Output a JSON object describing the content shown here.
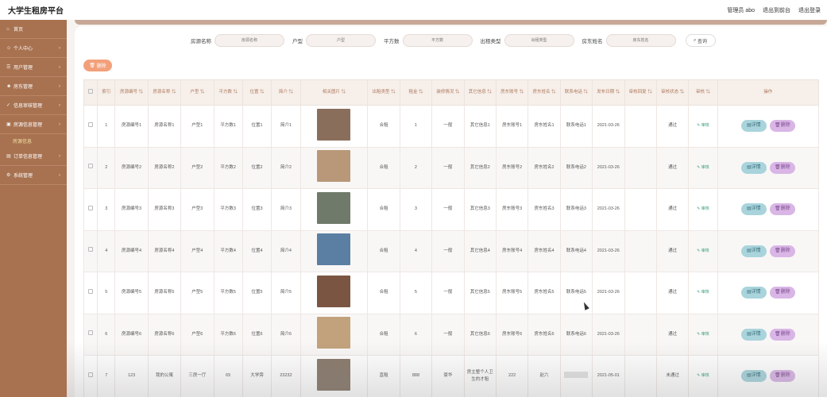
{
  "app": {
    "title": "大学生租房平台"
  },
  "topbar": {
    "user": "管理员 abo",
    "to_front": "退出到前台",
    "logout": "退出登录"
  },
  "sidebar": {
    "items": [
      {
        "label": "首页",
        "icon": "home-icon",
        "chev": ""
      },
      {
        "label": "个人中心",
        "icon": "user-icon",
        "chev": "›"
      },
      {
        "label": "用户管理",
        "icon": "users-icon",
        "chev": "›"
      },
      {
        "label": "房东管理",
        "icon": "person-icon",
        "chev": "›"
      },
      {
        "label": "信息审核管理",
        "icon": "check-icon",
        "chev": "›"
      },
      {
        "label": "房源信息管理",
        "icon": "house-icon",
        "chev": "›"
      }
    ],
    "active_sub": "房源信息",
    "items_after": [
      {
        "label": "订单信息管理",
        "icon": "order-icon",
        "chev": "›"
      },
      {
        "label": "系统管理",
        "icon": "gear-icon",
        "chev": "›"
      }
    ]
  },
  "search": {
    "fields": [
      {
        "label": "房源名称",
        "placeholder": "房源名称"
      },
      {
        "label": "户型",
        "placeholder": "户型"
      },
      {
        "label": "平方数",
        "placeholder": "平方数"
      },
      {
        "label": "出租类型",
        "placeholder": "出租类型"
      },
      {
        "label": "房东姓名",
        "placeholder": "房东姓名"
      }
    ],
    "button": "查询"
  },
  "toolbar": {
    "delete": "删除"
  },
  "table": {
    "headers": [
      "索引",
      "房源编号 ⇅",
      "房源名称 ⇅",
      "户型 ⇅",
      "平方数 ⇅",
      "位置 ⇅",
      "简介 ⇅",
      "相关图片 ⇅",
      "出租类型 ⇅",
      "租金 ⇅",
      "装修情况 ⇅",
      "其它信息 ⇅",
      "房东账号 ⇅",
      "房东姓名 ⇅",
      "联系电话 ⇅",
      "发布日期 ⇅",
      "审核回复 ⇅",
      "审核状态 ⇅",
      "审核 ⇅",
      "操作"
    ],
    "audit_label": "审核",
    "detail_label": "详情",
    "del_label": "删除",
    "rows": [
      {
        "idx": "1",
        "code": "房源编号1",
        "name": "房源名称1",
        "type": "户型1",
        "area": "平方数1",
        "loc": "位置1",
        "intro": "简介1",
        "img": "#8a6e5c",
        "rent_type": "合租",
        "rent": "1",
        "deco": "一般",
        "other": "其它信息1",
        "acct": "房东账号1",
        "lname": "房东姓名1",
        "phone": "联系电话1",
        "date": "2021-03-26",
        "reply": "",
        "status": "通过"
      },
      {
        "idx": "2",
        "code": "房源编号2",
        "name": "房源名称2",
        "type": "户型2",
        "area": "平方数2",
        "loc": "位置2",
        "intro": "简介2",
        "img": "#b89878",
        "rent_type": "合租",
        "rent": "2",
        "deco": "一般",
        "other": "其它信息2",
        "acct": "房东账号2",
        "lname": "房东姓名2",
        "phone": "联系电话2",
        "date": "2021-03-26",
        "reply": "",
        "status": "通过"
      },
      {
        "idx": "3",
        "code": "房源编号3",
        "name": "房源名称3",
        "type": "户型3",
        "area": "平方数3",
        "loc": "位置3",
        "intro": "简介3",
        "img": "#6f7a6a",
        "rent_type": "合租",
        "rent": "3",
        "deco": "一般",
        "other": "其它信息3",
        "acct": "房东账号3",
        "lname": "房东姓名3",
        "phone": "联系电话3",
        "date": "2021-03-26",
        "reply": "",
        "status": "通过"
      },
      {
        "idx": "4",
        "code": "房源编号4",
        "name": "房源名称4",
        "type": "户型4",
        "area": "平方数4",
        "loc": "位置4",
        "intro": "简介4",
        "img": "#5b7fa3",
        "rent_type": "合租",
        "rent": "4",
        "deco": "一般",
        "other": "其它信息4",
        "acct": "房东账号4",
        "lname": "房东姓名4",
        "phone": "联系电话4",
        "date": "2021-03-26",
        "reply": "",
        "status": "通过"
      },
      {
        "idx": "5",
        "code": "房源编号5",
        "name": "房源名称5",
        "type": "户型5",
        "area": "平方数5",
        "loc": "位置5",
        "intro": "简介5",
        "img": "#7a5642",
        "rent_type": "合租",
        "rent": "5",
        "deco": "一般",
        "other": "其它信息5",
        "acct": "房东账号5",
        "lname": "房东姓名5",
        "phone": "联系电话5",
        "date": "2021-03-26",
        "reply": "",
        "status": "通过"
      },
      {
        "idx": "6",
        "code": "房源编号6",
        "name": "房源名称6",
        "type": "户型6",
        "area": "平方数6",
        "loc": "位置6",
        "intro": "简介6",
        "img": "#c2a27c",
        "rent_type": "合租",
        "rent": "6",
        "deco": "一般",
        "other": "其它信息6",
        "acct": "房东账号6",
        "lname": "房东姓名6",
        "phone": "联系电话6",
        "date": "2021-03-26",
        "reply": "",
        "status": "通过"
      },
      {
        "idx": "7",
        "code": "123",
        "name": "我的公寓",
        "type": "三房一厅",
        "area": "65",
        "loc": "大学旁",
        "intro": "23232",
        "img": "#8a7a6c",
        "rent_type": "直租",
        "rent": "888",
        "deco": "豪华",
        "other": "房主整个人卫生的才租",
        "acct": "222",
        "lname": "赵六",
        "phone": "",
        "date": "2021-05-01",
        "reply": "",
        "status": "未通过"
      }
    ]
  }
}
